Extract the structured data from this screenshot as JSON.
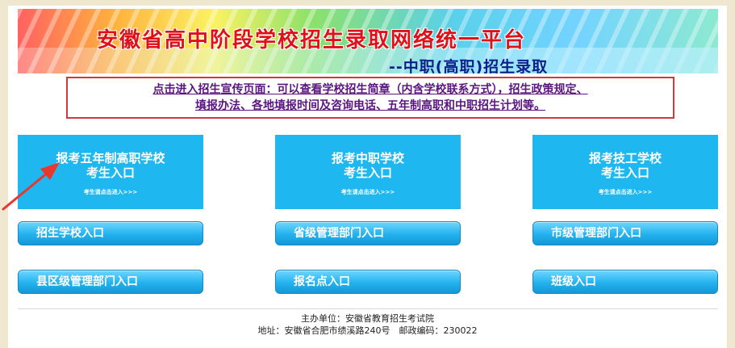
{
  "banner": {
    "title": "安徽省高中阶段学校招生录取网络统一平台",
    "subtitle": "--中职(高职)招生录取"
  },
  "notice": {
    "line1": "点击进入招生宣传页面：可以查看学校招生简章（内含学校联系方式），招生政策规定、",
    "line2": "填报办法、各地填报时间及咨询电话、五年制高职和中职招生计划等。"
  },
  "cards": [
    {
      "line1": "报考五年制高职学校",
      "line2": "考生入口",
      "hint": "考生请点击进入>>>"
    },
    {
      "line1": "报考中职学校",
      "line2": "考生入口",
      "hint": "考生请点击进入>>>"
    },
    {
      "line1": "报考技工学校",
      "line2": "考生入口",
      "hint": "考生请点击进入>>>"
    }
  ],
  "buttons": [
    {
      "label": "招生学校入口"
    },
    {
      "label": "省级管理部门入口"
    },
    {
      "label": "市级管理部门入口"
    },
    {
      "label": "县区级管理部门入口"
    },
    {
      "label": "报名点入口"
    },
    {
      "label": "班级入口"
    }
  ],
  "footer": {
    "line1": "主办单位：安徽省教育招生考试院",
    "line2": "地址：安徽省合肥市绩溪路240号　邮政编码：230022"
  },
  "colors": {
    "card_bg": "#1fb7ef",
    "title_red": "#e0101a",
    "notice_border": "#d13a3a",
    "arrow": "#e8382e"
  }
}
